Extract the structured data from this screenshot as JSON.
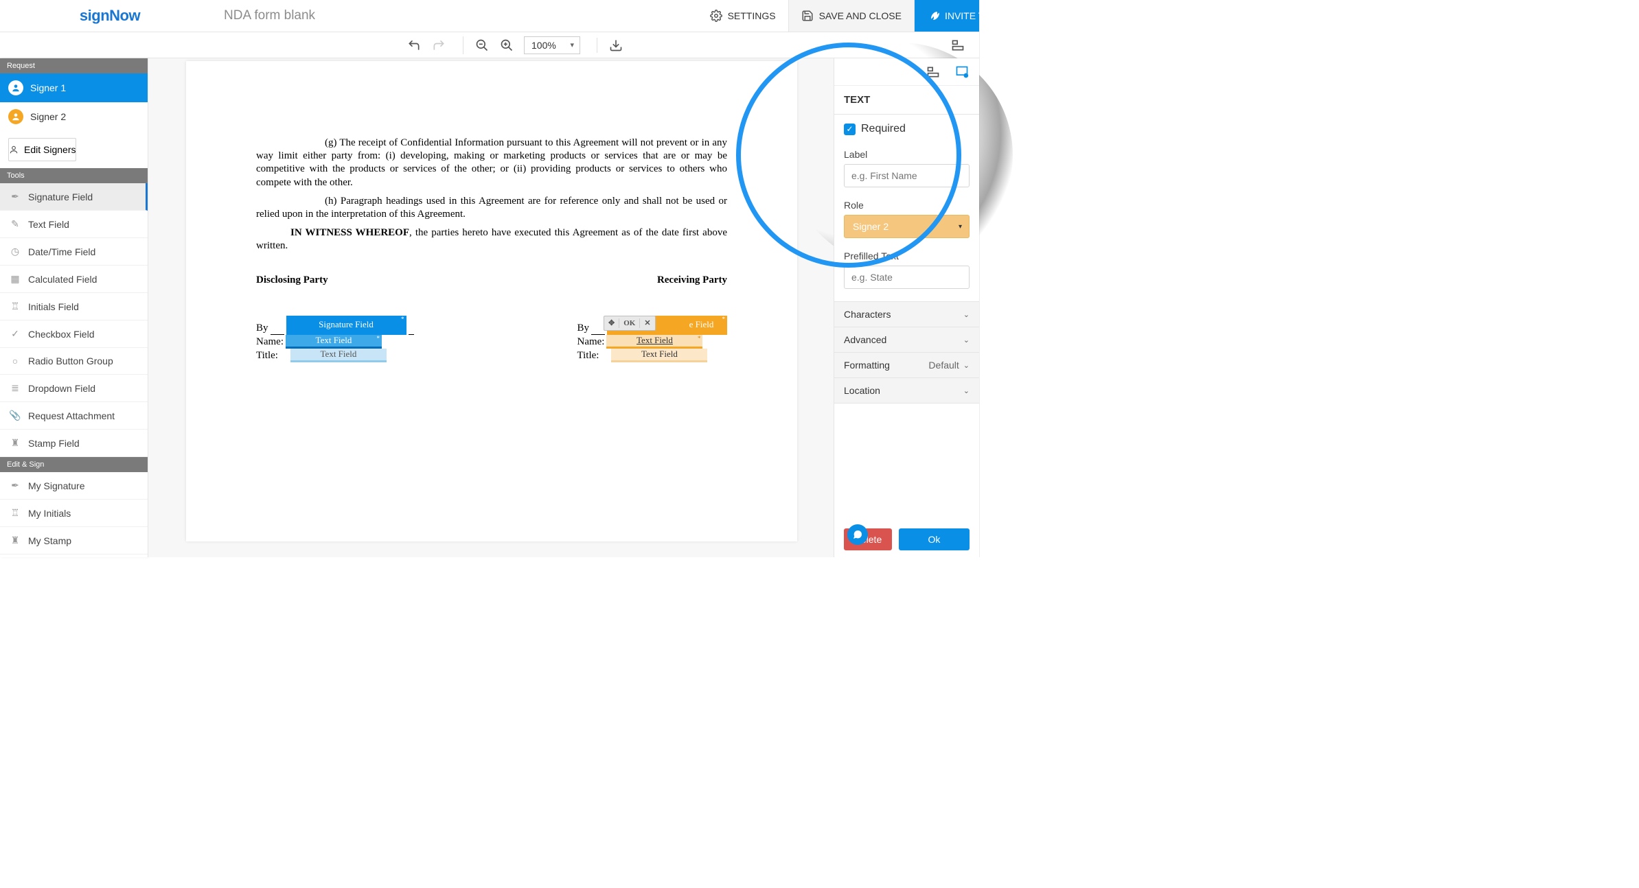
{
  "logo": "signNow",
  "doc_title": "NDA form blank",
  "top": {
    "settings": "SETTINGS",
    "save_close": "SAVE AND CLOSE",
    "invite": "INVITE TO SIGN"
  },
  "zoom_value": "100%",
  "sections": {
    "request": "Request",
    "tools": "Tools",
    "edit_sign": "Edit & Sign"
  },
  "signers": {
    "s1": "Signer 1",
    "s2": "Signer 2",
    "edit": "Edit Signers"
  },
  "tools": {
    "signature": "Signature Field",
    "text": "Text Field",
    "datetime": "Date/Time Field",
    "calculated": "Calculated Field",
    "initials": "Initials Field",
    "checkbox": "Checkbox Field",
    "radio": "Radio Button Group",
    "dropdown": "Dropdown Field",
    "attachment": "Request Attachment",
    "stamp": "Stamp Field"
  },
  "edit_sign_items": {
    "my_signature": "My Signature",
    "my_initials": "My Initials",
    "my_stamp": "My Stamp"
  },
  "doc": {
    "g": "(g)     The receipt of Confidential Information pursuant to this Agreement will not prevent or in any way limit either party from: (i) developing, making or marketing products or services that are or may be competitive with the products or services of the other; or (ii) providing products or services to others who compete with the other.",
    "h": "(h)     Paragraph headings used in this Agreement are for reference only and shall not be used or relied upon in the interpretation of this Agreement.",
    "witness_bold": "IN WITNESS WHEREOF",
    "witness_rest": ", the parties hereto have executed this Agreement as of the date first above written.",
    "disclosing": "Disclosing Party",
    "receiving": "Receiving Party",
    "by": "By",
    "name": "Name:",
    "title": "Title:",
    "sig_field": "Signature Field",
    "txt_field": "Text Field",
    "ok": "OK",
    "e_field": "e Field"
  },
  "panel": {
    "title": "TEXT",
    "required": "Required",
    "label": "Label",
    "label_ph": "e.g. First Name",
    "role": "Role",
    "role_value": "Signer 2",
    "prefilled": "Prefilled Text",
    "prefilled_ph": "e.g. State",
    "characters": "Characters",
    "advanced": "Advanced",
    "formatting": "Formatting",
    "formatting_val": "Default",
    "location": "Location",
    "delete": "Delete",
    "ok": "Ok"
  }
}
